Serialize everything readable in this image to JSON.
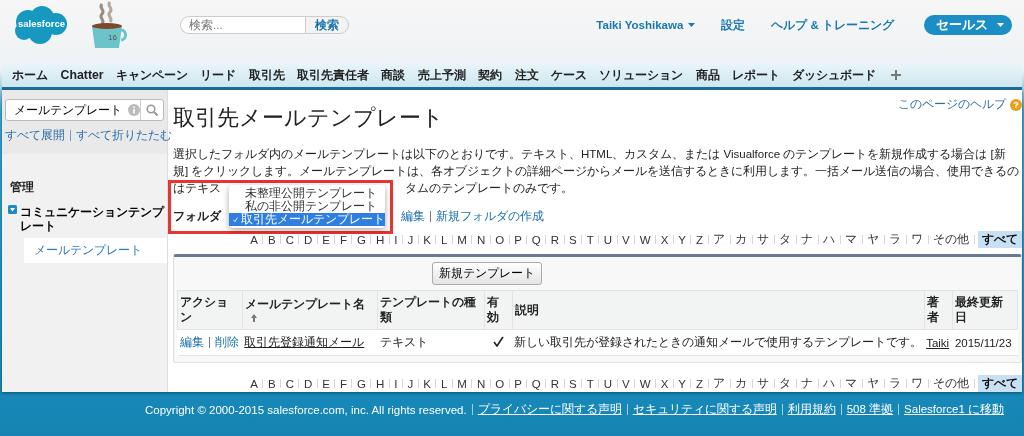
{
  "header": {
    "logo": "salesforce",
    "mascot_badge": "16",
    "search": {
      "placeholder": "検索...",
      "button": "検索"
    },
    "user": "Taiki Yoshikawa",
    "links": [
      "設定",
      "ヘルプ & トレーニング"
    ],
    "app_menu": "セールス"
  },
  "tabs": [
    "ホーム",
    "Chatter",
    "キャンペーン",
    "リード",
    "取引先",
    "取引先責任者",
    "商談",
    "売上予測",
    "契約",
    "注文",
    "ケース",
    "ソリューション",
    "商品",
    "レポート",
    "ダッシュボード"
  ],
  "sidebar": {
    "search": {
      "value": "メールテンプレート"
    },
    "expand_all": "すべて展開",
    "collapse_all": "すべて折りたたむ",
    "section": "管理",
    "tree": [
      {
        "label": "コミュニケーションテンプレート",
        "expanded": true,
        "children": [
          {
            "label": "メールテンプレート",
            "selected": true
          }
        ]
      }
    ]
  },
  "main": {
    "title": "取引先メールテンプレート",
    "help_link": "このページのヘルプ",
    "help_badge": "?",
    "description_lines": [
      "選択したフォルダ内のメールテンプレートは以下のとおりです。テキスト、HTML、カスタム、または Visualforce のテンプレートを新規作成する場合は [新",
      "規] をクリックします。メールテンプレートは、各オブジェクトの詳細ページからメールを送信するときに利用します。一括メール送信の場合、使用できるの"
    ],
    "description_tail": [
      "はテキス",
      "タムのテンプレートのみです。"
    ],
    "folder": {
      "label": "フォルダ",
      "links": [
        "編集",
        "新規フォルダの作成"
      ]
    },
    "folder_menu": [
      {
        "label": "未整理公開テンプレート",
        "selected": false
      },
      {
        "label": "私の非公開テンプレート",
        "selected": false
      },
      {
        "label": "取引先メールテンプレート",
        "selected": true
      }
    ],
    "alphabet_top": [
      {
        "label": "A",
        "selected": false
      },
      {
        "label": "B",
        "selected": false
      },
      {
        "label": "C",
        "selected": false
      },
      {
        "label": "D",
        "selected": false
      },
      {
        "label": "E",
        "selected": false
      },
      {
        "label": "F",
        "selected": false
      },
      {
        "label": "G",
        "selected": false
      },
      {
        "label": "H",
        "selected": false
      },
      {
        "label": "I",
        "selected": false
      },
      {
        "label": "J",
        "selected": false
      },
      {
        "label": "K",
        "selected": false
      },
      {
        "label": "L",
        "selected": false
      },
      {
        "label": "M",
        "selected": false
      },
      {
        "label": "N",
        "selected": false
      },
      {
        "label": "O",
        "selected": false
      },
      {
        "label": "P",
        "selected": false
      },
      {
        "label": "Q",
        "selected": false
      },
      {
        "label": "R",
        "selected": false
      },
      {
        "label": "S",
        "selected": false
      },
      {
        "label": "T",
        "selected": false
      },
      {
        "label": "U",
        "selected": false
      },
      {
        "label": "V",
        "selected": false
      },
      {
        "label": "W",
        "selected": false
      },
      {
        "label": "X",
        "selected": false
      },
      {
        "label": "Y",
        "selected": false
      },
      {
        "label": "Z",
        "selected": false
      },
      {
        "label": "ア",
        "selected": false
      },
      {
        "label": "カ",
        "selected": false
      },
      {
        "label": "サ",
        "selected": false
      },
      {
        "label": "タ",
        "selected": false
      },
      {
        "label": "ナ",
        "selected": false
      },
      {
        "label": "ハ",
        "selected": false
      },
      {
        "label": "マ",
        "selected": false
      },
      {
        "label": "ヤ",
        "selected": false
      },
      {
        "label": "ラ",
        "selected": false
      },
      {
        "label": "ワ",
        "selected": false
      },
      {
        "label": "その他",
        "selected": false
      },
      {
        "label": "すべて",
        "selected": true
      }
    ],
    "table": {
      "new_button": "新規テンプレート",
      "columns": [
        {
          "label": "アクション",
          "sorted": false
        },
        {
          "label": "メールテンプレート名",
          "sorted": true
        },
        {
          "label": "テンプレートの種類",
          "sorted": false
        },
        {
          "label": "有効",
          "sorted": false
        },
        {
          "label": "説明",
          "sorted": false
        },
        {
          "label": "著者",
          "sorted": false
        },
        {
          "label": "最終更新日",
          "sorted": false
        }
      ],
      "rows": [
        {
          "actions": [
            "編集",
            "削除"
          ],
          "name": "取引先登録通知メール",
          "type": "テキスト",
          "active": true,
          "description": "新しい取引先が登録されたときの通知メールで使用するテンプレートです。",
          "author": "Taiki",
          "modified": "2015/11/23"
        }
      ]
    },
    "alphabet_bottom": [
      {
        "label": "A",
        "selected": false
      },
      {
        "label": "B",
        "selected": false
      },
      {
        "label": "C",
        "selected": false
      },
      {
        "label": "D",
        "selected": false
      },
      {
        "label": "E",
        "selected": false
      },
      {
        "label": "F",
        "selected": false
      },
      {
        "label": "G",
        "selected": false
      },
      {
        "label": "H",
        "selected": false
      },
      {
        "label": "I",
        "selected": false
      },
      {
        "label": "J",
        "selected": false
      },
      {
        "label": "K",
        "selected": false
      },
      {
        "label": "L",
        "selected": false
      },
      {
        "label": "M",
        "selected": false
      },
      {
        "label": "N",
        "selected": false
      },
      {
        "label": "O",
        "selected": false
      },
      {
        "label": "P",
        "selected": false
      },
      {
        "label": "Q",
        "selected": false
      },
      {
        "label": "R",
        "selected": false
      },
      {
        "label": "S",
        "selected": false
      },
      {
        "label": "T",
        "selected": false
      },
      {
        "label": "U",
        "selected": false
      },
      {
        "label": "V",
        "selected": false
      },
      {
        "label": "W",
        "selected": false
      },
      {
        "label": "X",
        "selected": false
      },
      {
        "label": "Y",
        "selected": false
      },
      {
        "label": "Z",
        "selected": false
      },
      {
        "label": "ア",
        "selected": false
      },
      {
        "label": "カ",
        "selected": false
      },
      {
        "label": "サ",
        "selected": false
      },
      {
        "label": "タ",
        "selected": false
      },
      {
        "label": "ナ",
        "selected": false
      },
      {
        "label": "ハ",
        "selected": false
      },
      {
        "label": "マ",
        "selected": false
      },
      {
        "label": "ヤ",
        "selected": false
      },
      {
        "label": "ラ",
        "selected": false
      },
      {
        "label": "ワ",
        "selected": false
      },
      {
        "label": "その他",
        "selected": false
      },
      {
        "label": "すべて",
        "selected": true
      }
    ]
  },
  "footer": {
    "copyright": "Copyright © 2000-2015 salesforce.com, inc. All rights reserved.",
    "links": [
      "プライバシーに関する声明",
      "セキュリティに関する声明",
      "利用規約",
      "508 準拠",
      "Salesforce1 に移動"
    ]
  }
}
